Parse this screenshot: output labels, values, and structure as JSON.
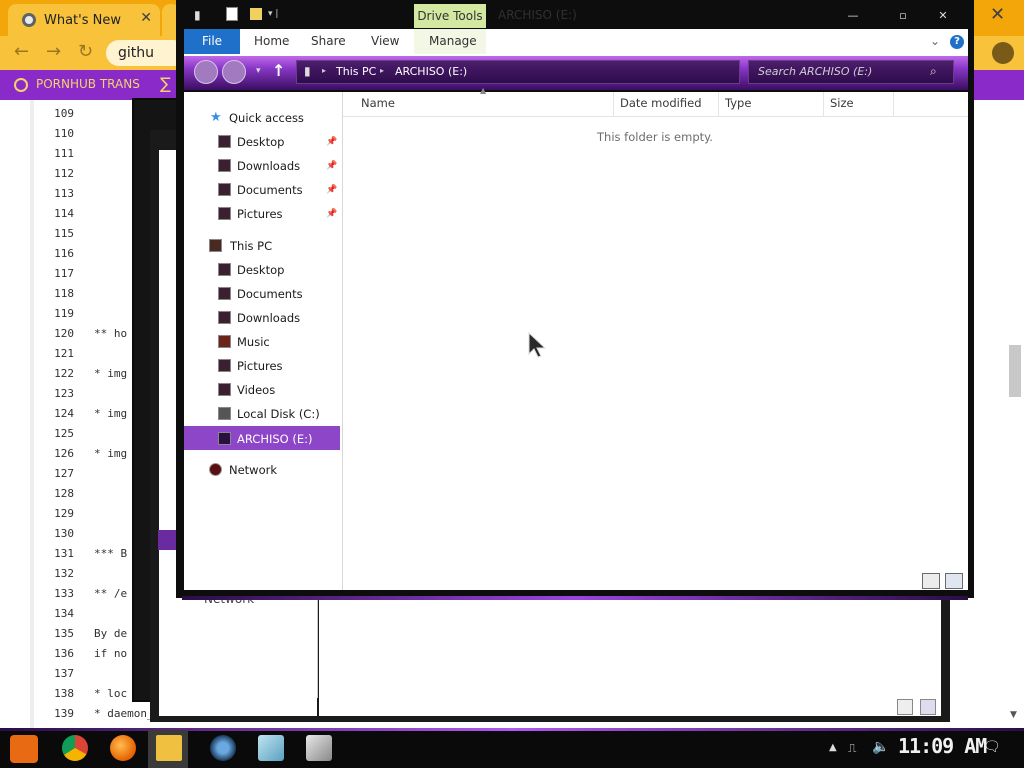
{
  "browser": {
    "tabs": [
      {
        "title": "What's New"
      }
    ],
    "omnibox_text": "githu",
    "bookmark_label": "PORNHUB TRANS"
  },
  "code_editor": {
    "lines": [
      {
        "n": "109",
        "text": ""
      },
      {
        "n": "110",
        "text": ""
      },
      {
        "n": "111",
        "text": ""
      },
      {
        "n": "112",
        "text": ""
      },
      {
        "n": "113",
        "text": ""
      },
      {
        "n": "114",
        "text": ""
      },
      {
        "n": "115",
        "text": ""
      },
      {
        "n": "116",
        "text": ""
      },
      {
        "n": "117",
        "text": ""
      },
      {
        "n": "118",
        "text": ""
      },
      {
        "n": "119",
        "text": ""
      },
      {
        "n": "120",
        "text": "** ho"
      },
      {
        "n": "121",
        "text": ""
      },
      {
        "n": "122",
        "text": "* img"
      },
      {
        "n": "123",
        "text": ""
      },
      {
        "n": "124",
        "text": "* img"
      },
      {
        "n": "125",
        "text": ""
      },
      {
        "n": "126",
        "text": "* img"
      },
      {
        "n": "127",
        "text": ""
      },
      {
        "n": "128",
        "text": ""
      },
      {
        "n": "129",
        "text": ""
      },
      {
        "n": "130",
        "text": ""
      },
      {
        "n": "131",
        "text": "*** B"
      },
      {
        "n": "132",
        "text": ""
      },
      {
        "n": "133",
        "text": "** /e"
      },
      {
        "n": "134",
        "text": ""
      },
      {
        "n": "135",
        "text": "By de"
      },
      {
        "n": "136",
        "text": "if no"
      },
      {
        "n": "137",
        "text": ""
      },
      {
        "n": "138",
        "text": "* loc"
      },
      {
        "n": "139",
        "text": "* daemon_"
      }
    ]
  },
  "background_window": {
    "nav_label": "Network"
  },
  "explorer": {
    "title": "ARCHISO (E:)",
    "context_tab": "Drive Tools",
    "ribbon_tabs": [
      "File",
      "Home",
      "Share",
      "View",
      "Manage"
    ],
    "breadcrumb": [
      "This PC",
      "ARCHISO (E:)"
    ],
    "search_placeholder": "Search ARCHISO (E:)",
    "columns": [
      "Name",
      "Date modified",
      "Type",
      "Size"
    ],
    "empty_message": "This folder is empty.",
    "nav": {
      "quick_access": {
        "label": "Quick access",
        "items": [
          "Desktop",
          "Downloads",
          "Documents",
          "Pictures"
        ]
      },
      "this_pc": {
        "label": "This PC",
        "items": [
          "Desktop",
          "Documents",
          "Downloads",
          "Music",
          "Pictures",
          "Videos",
          "Local Disk (C:)",
          "ARCHISO (E:)"
        ]
      },
      "network": "Network",
      "selected": "ARCHISO (E:)"
    },
    "accent_color": "#8e46c8"
  },
  "taskbar": {
    "clock": "11:09 AM",
    "pinned_apps": [
      "start-icon",
      "chrome-icon",
      "firefox-icon",
      "file-explorer-icon",
      "app-icon-blue-circle",
      "app-icon-glass",
      "app-icon-box"
    ]
  }
}
